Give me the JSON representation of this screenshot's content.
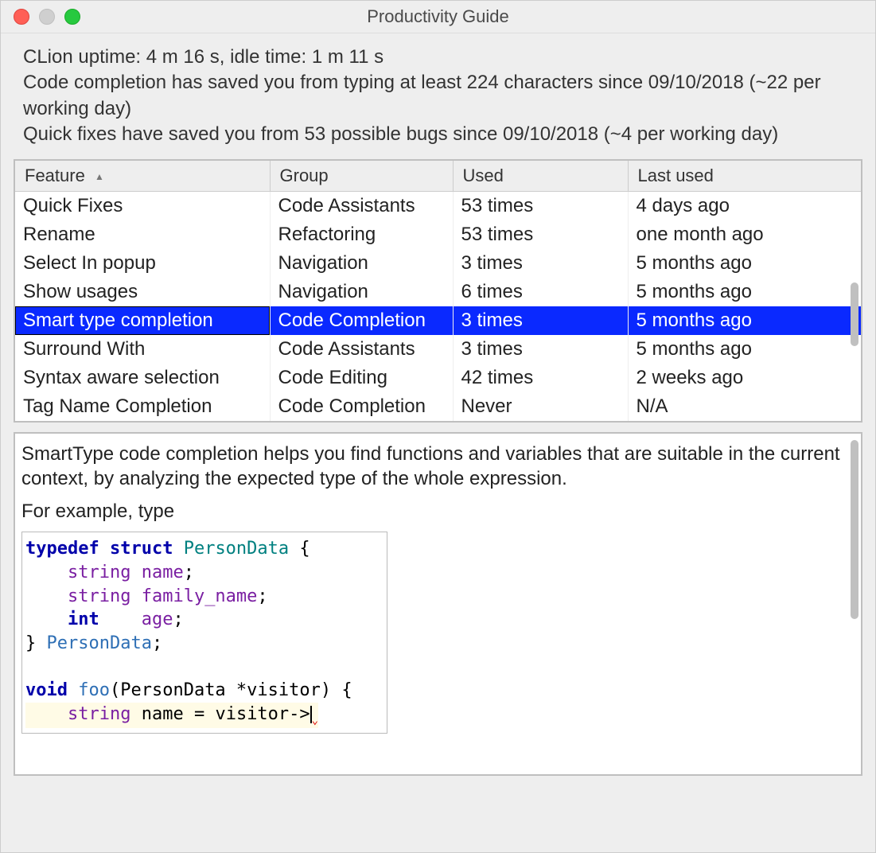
{
  "window_title": "Productivity Guide",
  "stats": {
    "line1": "CLion uptime: 4 m 16 s, idle time: 1 m 11 s",
    "line2": "Code completion has saved you from typing at least 224 characters since 09/10/2018 (~22 per working day)",
    "line3": "Quick fixes have saved you from 53 possible bugs since 09/10/2018 (~4 per working day)"
  },
  "columns": {
    "feature": "Feature",
    "group": "Group",
    "used": "Used",
    "last": "Last used"
  },
  "rows": [
    {
      "feature": "Quick Fixes",
      "group": "Code Assistants",
      "used": "53 times",
      "last": "4 days ago",
      "selected": false
    },
    {
      "feature": "Rename",
      "group": "Refactoring",
      "used": "53 times",
      "last": "one month ago",
      "selected": false
    },
    {
      "feature": "Select In popup",
      "group": "Navigation",
      "used": "3 times",
      "last": "5 months ago",
      "selected": false
    },
    {
      "feature": "Show usages",
      "group": "Navigation",
      "used": "6 times",
      "last": "5 months ago",
      "selected": false
    },
    {
      "feature": "Smart type completion",
      "group": "Code Completion",
      "used": "3 times",
      "last": "5 months ago",
      "selected": true
    },
    {
      "feature": "Surround With",
      "group": "Code Assistants",
      "used": "3 times",
      "last": "5 months ago",
      "selected": false
    },
    {
      "feature": "Syntax aware selection",
      "group": "Code Editing",
      "used": "42 times",
      "last": "2 weeks ago",
      "selected": false
    },
    {
      "feature": "Tag Name Completion",
      "group": "Code Completion",
      "used": "Never",
      "last": "N/A",
      "selected": false
    }
  ],
  "detail": {
    "p1": "SmartType code completion helps you find functions and variables that are suitable in the current context, by analyzing the expected type of the whole expression.",
    "p2": "For example, type"
  },
  "code": {
    "t_typedef": "typedef",
    "t_struct": "struct",
    "t_PersonData": "PersonData",
    "t_brace_open": " {",
    "t_string": "string",
    "t_name": "name",
    "t_semi": ";",
    "t_family": "family_name",
    "t_int": "int",
    "t_age": "age",
    "t_close": "} ",
    "t_PersonData2": "PersonData",
    "t_semi2": ";",
    "t_void": "void",
    "t_foo": "foo",
    "t_sig": "(PersonData *visitor) {",
    "t_body_string": "string",
    "t_body_name": "name",
    "t_eq": " = ",
    "t_visitor": "visitor",
    "t_arrow": "->"
  }
}
